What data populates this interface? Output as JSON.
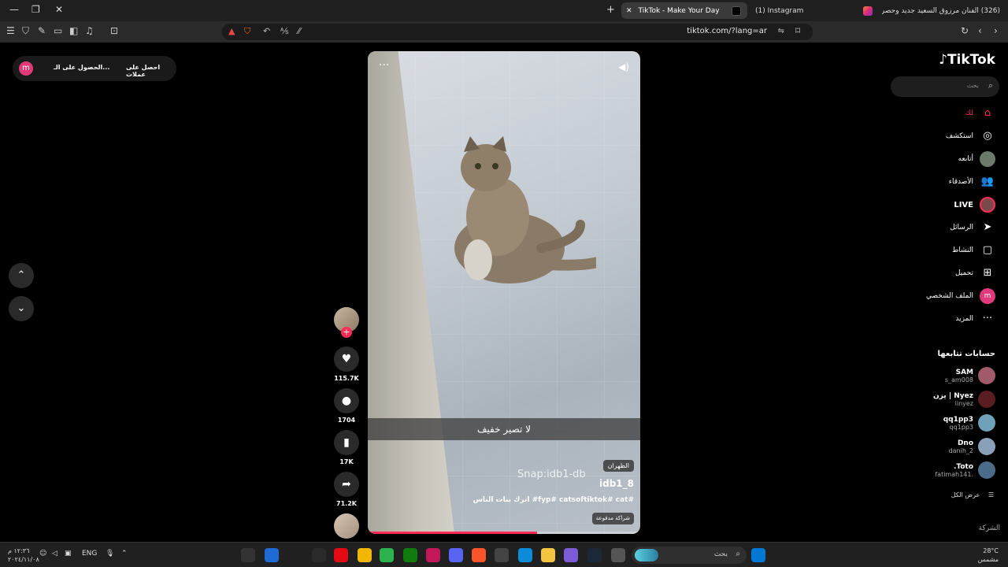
{
  "browser": {
    "tabs": [
      {
        "label": "TikTok - Make Your Day",
        "active": true
      },
      {
        "label": "(1) Instagram",
        "active": false
      },
      {
        "label": "(326) الفنان مرزوق السعيد جديد وحصري",
        "active": false
      }
    ],
    "new_tab": "+",
    "url": "tiktok.com/?lang=ar"
  },
  "coins_bar": {
    "avatar_letter": "m",
    "get_coins": "الحصول على الـ...",
    "get_coins_offer": "احصل على عملات"
  },
  "logo": "TikTok",
  "search": {
    "placeholder": "بحث"
  },
  "nav": [
    {
      "label": "لك",
      "icon": "home-icon",
      "glyph": "⌂",
      "active": true
    },
    {
      "label": "استكشف",
      "icon": "compass-icon",
      "glyph": "◎"
    },
    {
      "label": "أتابعه",
      "icon": "following-avatar",
      "glyph": ""
    },
    {
      "label": "الأصدقاء",
      "icon": "friends-icon",
      "glyph": "👥"
    },
    {
      "label": "LIVE",
      "icon": "live-avatar",
      "glyph": ""
    },
    {
      "label": "الرسائل",
      "icon": "send-icon",
      "glyph": "➤"
    },
    {
      "label": "النشاط",
      "icon": "activity-icon",
      "glyph": "▢"
    },
    {
      "label": "تحميل",
      "icon": "upload-icon",
      "glyph": "⊞"
    },
    {
      "label": "الملف الشخصي",
      "icon": "profile-avatar",
      "glyph": "m"
    },
    {
      "label": "المزيد",
      "icon": "more-icon",
      "glyph": "···"
    }
  ],
  "following": {
    "title": "حسابات تتابعها",
    "accounts": [
      {
        "name": "SAM",
        "handle": "s_am008"
      },
      {
        "name": "يزن | Nyez",
        "handle": "iinyez"
      },
      {
        "name": "qq1pp3",
        "handle": "qq1pp3"
      },
      {
        "name": "Dno",
        "handle": "danih_2"
      },
      {
        "name": ".Toto",
        "handle": "fatimah141."
      }
    ],
    "show_all": "عرض الكل"
  },
  "company": "الشركة",
  "video": {
    "caption": "لا تصير خفيف",
    "watermark": "Snap:idb1-db",
    "location": "الظهران",
    "author": "idb1_8",
    "description": "اترك بنات الناس #fyp# catsoftiktok# cat#",
    "paid_badge": "شراكة مدفوعة",
    "progress": 0.62
  },
  "actions": {
    "likes": "115.7K",
    "comments": "1704",
    "saves": "17K",
    "shares": "71.2K"
  },
  "taskbar": {
    "search_placeholder": "بحث",
    "language": "ENG",
    "time": "١٢:٣٦ م",
    "date": "٢٠٢٤/١١/٠٨",
    "temperature": "28°C",
    "weather": "مشمس"
  },
  "colors": {
    "accent": "#fe2c55",
    "brand_pink": "#e13a7a"
  }
}
